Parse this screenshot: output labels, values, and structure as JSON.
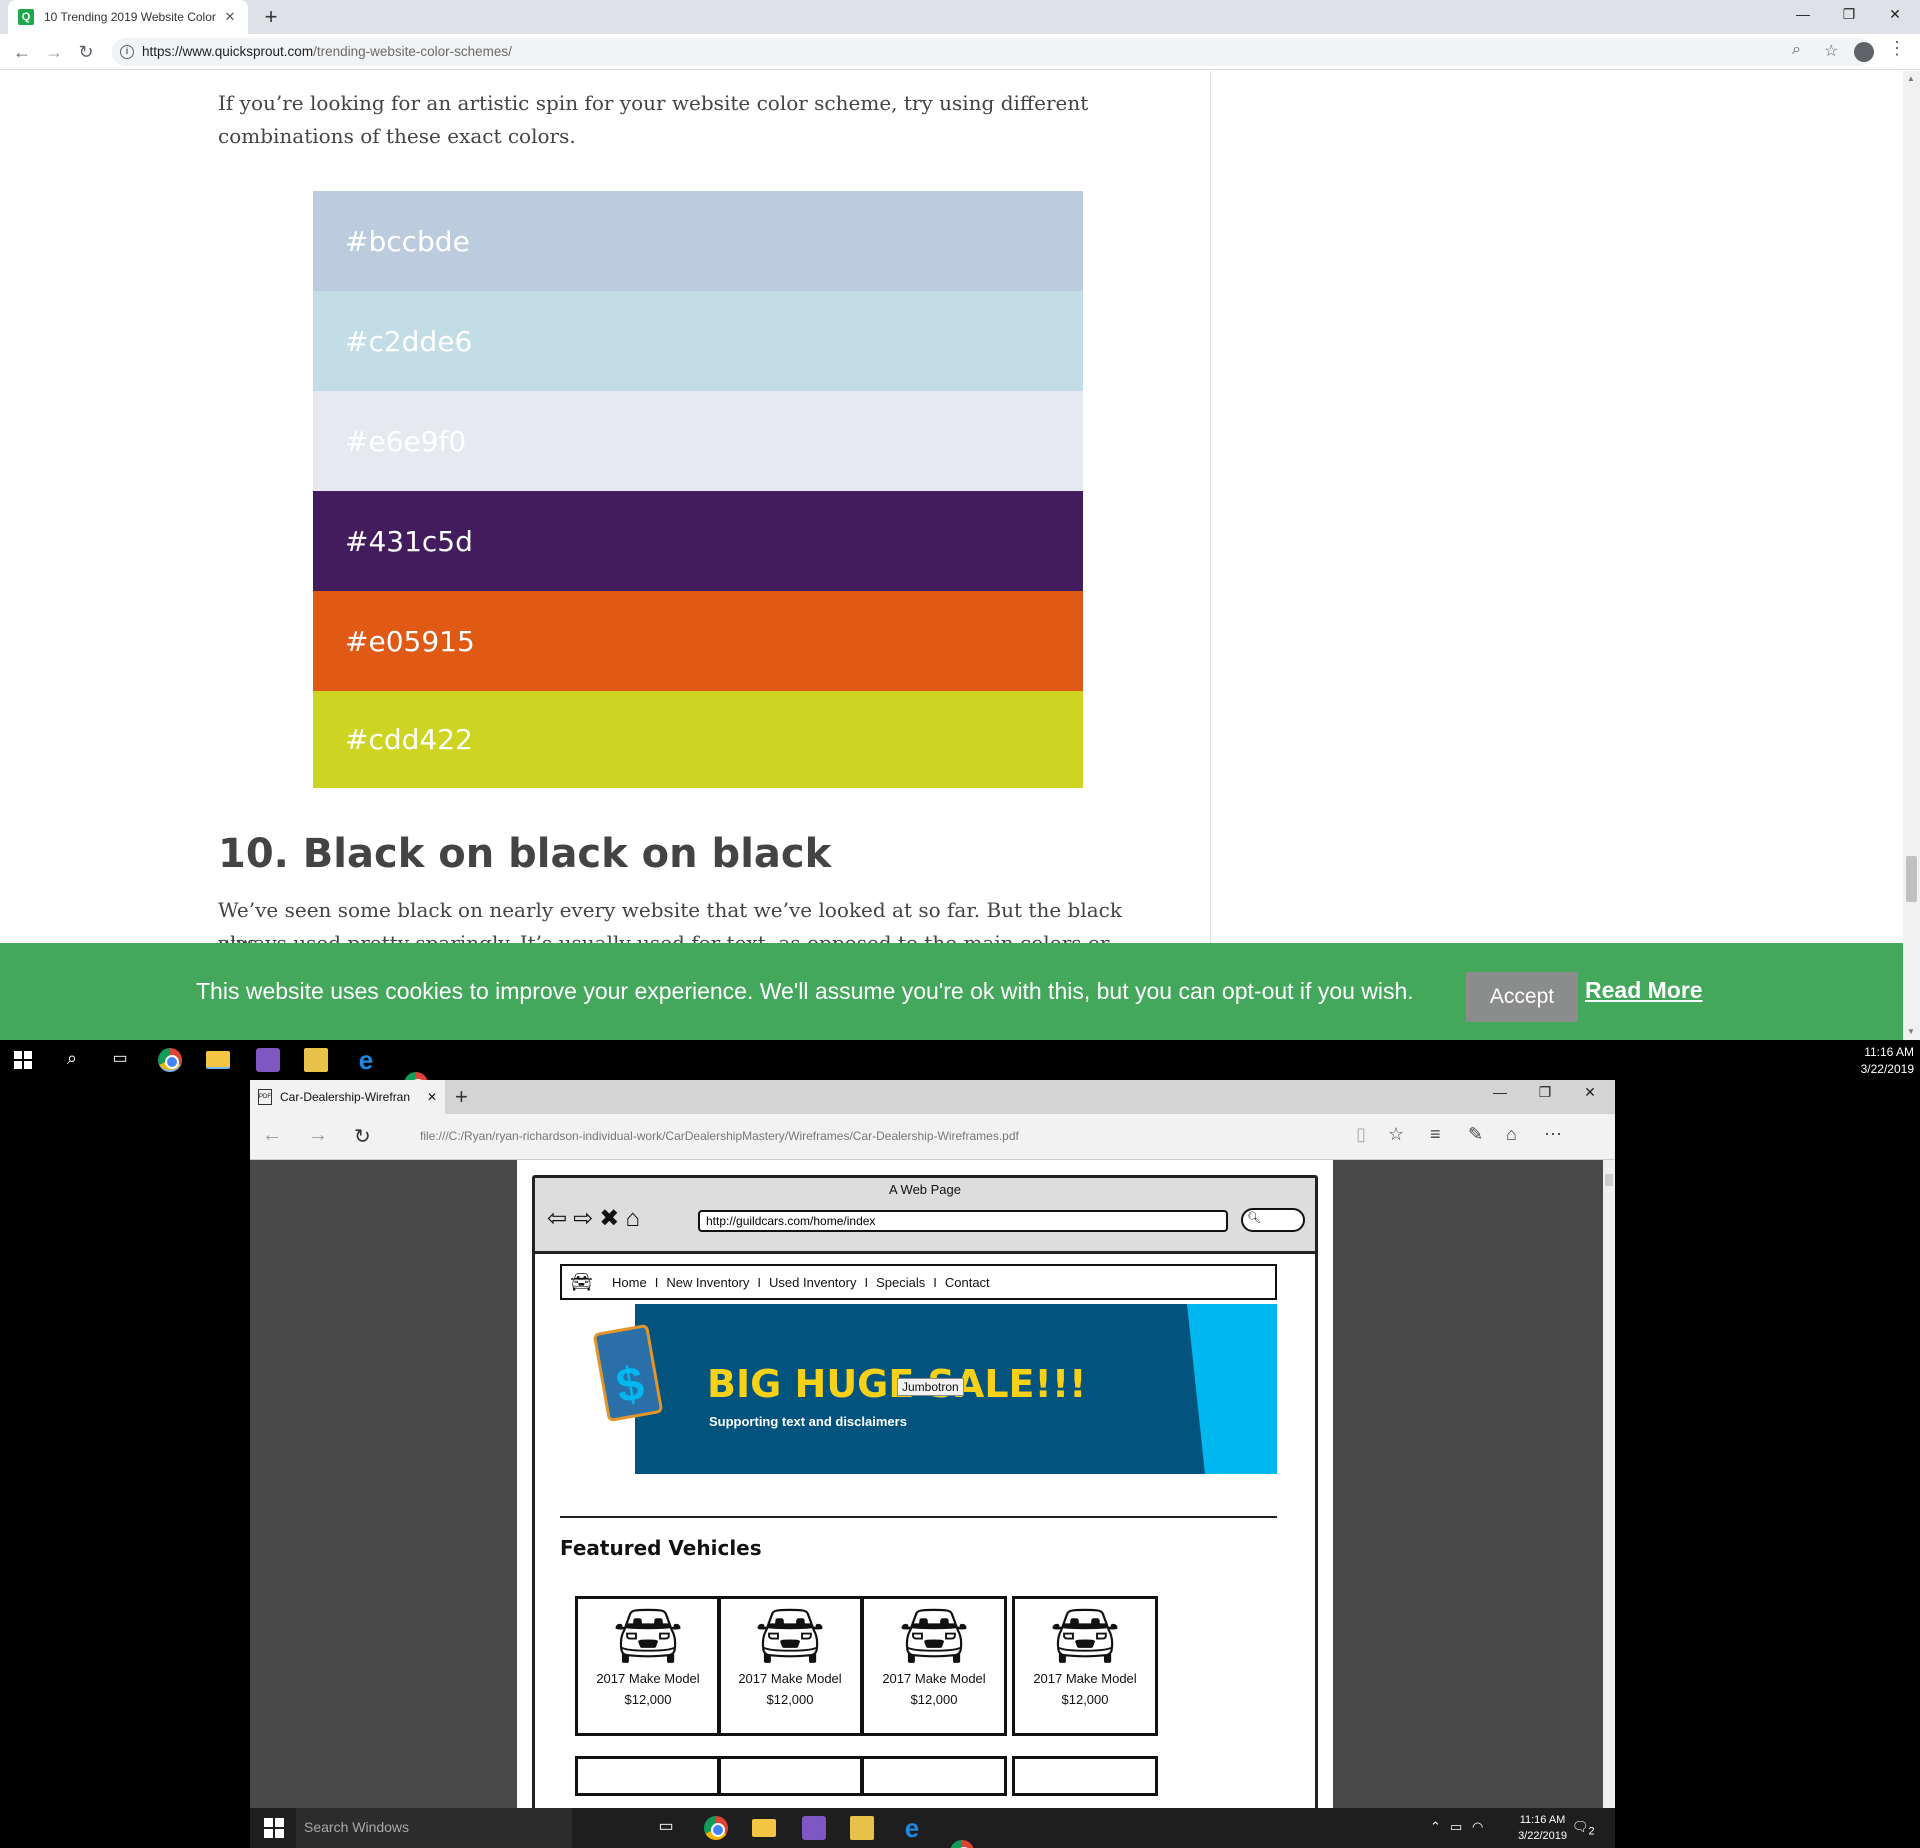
{
  "chrome": {
    "tab_title": "10 Trending 2019 Website Color",
    "favicon_letter": "Q",
    "url_host": "https://www.quicksprout.com",
    "url_path": "/trending-website-color-schemes/"
  },
  "article": {
    "intro": "If you’re looking for an artistic spin for your website color scheme, try using different combinations of these exact colors.",
    "swatches": [
      {
        "hex": "#bccbde",
        "label": "#bccbde",
        "text_color": "#ffffff"
      },
      {
        "hex": "#c2dde6",
        "label": "#c2dde6",
        "text_color": "#ffffff"
      },
      {
        "hex": "#e6e9f0",
        "label": "#e6e9f0",
        "text_color": "#ffffff"
      },
      {
        "hex": "#431c5d",
        "label": "#431c5d",
        "text_color": "#ffffff"
      },
      {
        "hex": "#e05915",
        "label": "#e05915",
        "text_color": "#ffffff"
      },
      {
        "hex": "#cdd422",
        "label": "#cdd422",
        "text_color": "#ffffff"
      }
    ],
    "heading": "10. Black on black on black",
    "para2": "We’ve seen some black on nearly every website that we’ve looked at so far. But the black was",
    "para3": "always used pretty sparingly. It’s usually used for text, as opposed to the main colors or"
  },
  "cookie": {
    "message": "This website uses cookies to improve your experience. We'll assume you're ok with this, but you can opt-out if you wish.",
    "accept": "Accept",
    "read_more": "Read More"
  },
  "taskbar_top": {
    "time": "11:16 AM",
    "date": "3/22/2019"
  },
  "edge": {
    "tab_title": "Car-Dealership-Wirefran",
    "url": "file:///C:/Ryan/ryan-richardson-individual-work/CarDealershipMastery/Wireframes/Car-Dealership-Wireframes.pdf"
  },
  "wireframe": {
    "title": "A Web Page",
    "url": "http://guildcars.com/home/index",
    "nav": [
      "Home",
      "New Inventory",
      "Used Inventory",
      "Specials",
      "Contact"
    ],
    "jumbo_headline": "BIG HUGE SALE!!!",
    "jumbo_sub": "Supporting text and disclaimers",
    "jumbo_label": "Jumbotron",
    "featured": "Featured Vehicles",
    "cards": [
      {
        "name": "2017 Make Model",
        "price": "$12,000"
      },
      {
        "name": "2017 Make Model",
        "price": "$12,000"
      },
      {
        "name": "2017 Make Model",
        "price": "$12,000"
      },
      {
        "name": "2017 Make Model",
        "price": "$12,000"
      }
    ]
  },
  "taskbar_bottom": {
    "search_placeholder": "Search Windows",
    "time": "11:16 AM",
    "date": "3/22/2019",
    "notif_count": "2"
  }
}
